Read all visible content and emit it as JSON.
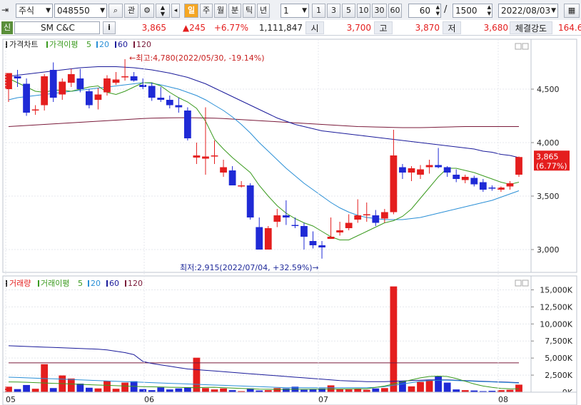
{
  "toolbar": {
    "market_select": "주식",
    "code": "048550",
    "btn_search_alt": "관",
    "period_selected": "일",
    "period_tabs": [
      "주",
      "월",
      "분",
      "틱",
      "년"
    ],
    "interval_value": "1",
    "interval_buttons": [
      "1",
      "3",
      "5",
      "10",
      "30",
      "60"
    ],
    "count_value": "60",
    "count_sep": "/",
    "count_total": "1500",
    "date_value": "2022/08/03"
  },
  "info": {
    "credit_badge": "신",
    "name": "SM C&C",
    "info_btn": "i",
    "price": "3,865",
    "change": "▲245",
    "change_pct": "+6.77%",
    "volume": "1,111,847",
    "open_label": "시",
    "open": "3,700",
    "high_label": "고",
    "high": "3,870",
    "low_label": "저",
    "low": "3,680",
    "strength_label": "체결강도",
    "strength": "164.6"
  },
  "colors": {
    "up": "#e41e1e",
    "down": "#1f2ad6",
    "ma5": "#3a9a1e",
    "ma20": "#2a8fd6",
    "ma60": "#1a1a9a",
    "ma120": "#7a1a3a"
  },
  "price_legend": {
    "title": "가격차트",
    "ma_label": "가격이평",
    "periods": [
      "5",
      "20",
      "60",
      "120"
    ]
  },
  "volume_legend": {
    "title": "거래량",
    "ma_label": "거래이평",
    "periods": [
      "5",
      "20",
      "60",
      "120"
    ]
  },
  "annotations": {
    "high": "←최고:4,780(2022/05/30, -19.14%)",
    "low": "최저:2,915(2022/07/04, +32.59%)→"
  },
  "current_tag": {
    "price": "3,865",
    "pct": "(6.77%)"
  },
  "chart_data": {
    "type": "candlestick",
    "x_labels": [
      "05",
      "06",
      "07",
      "08"
    ],
    "price_ticks": [
      "4,500",
      "4,000",
      "3,500",
      "3,000"
    ],
    "volume_ticks": [
      "15,000K",
      "12,500K",
      "10,000K",
      "7,500K",
      "5,000K",
      "2,500K",
      "0K"
    ],
    "candles": [
      {
        "o": 4500,
        "h": 4650,
        "l": 4380,
        "c": 4650
      },
      {
        "o": 4620,
        "h": 4680,
        "l": 4520,
        "c": 4600
      },
      {
        "o": 4550,
        "h": 4600,
        "l": 4250,
        "c": 4280
      },
      {
        "o": 4300,
        "h": 4350,
        "l": 4260,
        "c": 4310
      },
      {
        "o": 4350,
        "h": 4640,
        "l": 4300,
        "c": 4620
      },
      {
        "o": 4680,
        "h": 4750,
        "l": 4380,
        "c": 4420
      },
      {
        "o": 4450,
        "h": 4600,
        "l": 4400,
        "c": 4570
      },
      {
        "o": 4560,
        "h": 4690,
        "l": 4520,
        "c": 4640
      },
      {
        "o": 4600,
        "h": 4690,
        "l": 4470,
        "c": 4500
      },
      {
        "o": 4480,
        "h": 4500,
        "l": 4320,
        "c": 4350
      },
      {
        "o": 4400,
        "h": 4510,
        "l": 4310,
        "c": 4450
      },
      {
        "o": 4470,
        "h": 4630,
        "l": 4440,
        "c": 4600
      },
      {
        "o": 4560,
        "h": 4660,
        "l": 4540,
        "c": 4590
      },
      {
        "o": 4620,
        "h": 4780,
        "l": 4580,
        "c": 4620
      },
      {
        "o": 4620,
        "h": 4660,
        "l": 4570,
        "c": 4580
      },
      {
        "o": 4540,
        "h": 4600,
        "l": 4500,
        "c": 4520
      },
      {
        "o": 4530,
        "h": 4560,
        "l": 4390,
        "c": 4420
      },
      {
        "o": 4420,
        "h": 4520,
        "l": 4380,
        "c": 4400
      },
      {
        "o": 4400,
        "h": 4440,
        "l": 4320,
        "c": 4350
      },
      {
        "o": 4350,
        "h": 4420,
        "l": 4280,
        "c": 4330
      },
      {
        "o": 4300,
        "h": 4330,
        "l": 4020,
        "c": 4040
      },
      {
        "o": 3860,
        "h": 4000,
        "l": 3800,
        "c": 3880
      },
      {
        "o": 3850,
        "h": 4330,
        "l": 3700,
        "c": 3870
      },
      {
        "o": 3880,
        "h": 4020,
        "l": 3800,
        "c": 3880
      },
      {
        "o": 3720,
        "h": 3840,
        "l": 3680,
        "c": 3770
      },
      {
        "o": 3740,
        "h": 3780,
        "l": 3600,
        "c": 3600
      },
      {
        "o": 3600,
        "h": 3640,
        "l": 3580,
        "c": 3600
      },
      {
        "o": 3600,
        "h": 3620,
        "l": 3280,
        "c": 3300
      },
      {
        "o": 3210,
        "h": 3300,
        "l": 3000,
        "c": 3000
      },
      {
        "o": 3000,
        "h": 3220,
        "l": 3000,
        "c": 3200
      },
      {
        "o": 3260,
        "h": 3380,
        "l": 3210,
        "c": 3320
      },
      {
        "o": 3320,
        "h": 3460,
        "l": 3230,
        "c": 3300
      },
      {
        "o": 3230,
        "h": 3300,
        "l": 3200,
        "c": 3220
      },
      {
        "o": 3220,
        "h": 3250,
        "l": 3000,
        "c": 3120
      },
      {
        "o": 3080,
        "h": 3170,
        "l": 3010,
        "c": 3040
      },
      {
        "o": 3040,
        "h": 3080,
        "l": 2915,
        "c": 3020
      },
      {
        "o": 3100,
        "h": 3300,
        "l": 3100,
        "c": 3120
      },
      {
        "o": 3160,
        "h": 3260,
        "l": 3130,
        "c": 3180
      },
      {
        "o": 3200,
        "h": 3330,
        "l": 3180,
        "c": 3250
      },
      {
        "o": 3280,
        "h": 3470,
        "l": 3250,
        "c": 3320
      },
      {
        "o": 3330,
        "h": 3440,
        "l": 3260,
        "c": 3330
      },
      {
        "o": 3320,
        "h": 3370,
        "l": 3220,
        "c": 3250
      },
      {
        "o": 3290,
        "h": 3380,
        "l": 3250,
        "c": 3350
      },
      {
        "o": 3350,
        "h": 4120,
        "l": 3330,
        "c": 3880
      },
      {
        "o": 3770,
        "h": 3800,
        "l": 3660,
        "c": 3720
      },
      {
        "o": 3720,
        "h": 3780,
        "l": 3640,
        "c": 3760
      },
      {
        "o": 3700,
        "h": 3790,
        "l": 3660,
        "c": 3750
      },
      {
        "o": 3770,
        "h": 3840,
        "l": 3710,
        "c": 3790
      },
      {
        "o": 3790,
        "h": 3950,
        "l": 3760,
        "c": 3770
      },
      {
        "o": 3770,
        "h": 3780,
        "l": 3680,
        "c": 3720
      },
      {
        "o": 3700,
        "h": 3750,
        "l": 3630,
        "c": 3660
      },
      {
        "o": 3650,
        "h": 3700,
        "l": 3620,
        "c": 3680
      },
      {
        "o": 3670,
        "h": 3690,
        "l": 3590,
        "c": 3610
      },
      {
        "o": 3630,
        "h": 3660,
        "l": 3540,
        "c": 3560
      },
      {
        "o": 3580,
        "h": 3600,
        "l": 3550,
        "c": 3570
      },
      {
        "o": 3560,
        "h": 3590,
        "l": 3540,
        "c": 3580
      },
      {
        "o": 3590,
        "h": 3640,
        "l": 3560,
        "c": 3620
      },
      {
        "o": 3700,
        "h": 3870,
        "l": 3680,
        "c": 3865
      }
    ],
    "volumes_k": [
      800,
      450,
      1050,
      500,
      4100,
      600,
      2450,
      2000,
      1250,
      650,
      550,
      1650,
      500,
      1400,
      1600,
      450,
      300,
      700,
      400,
      550,
      700,
      5050,
      600,
      400,
      550,
      300,
      150,
      550,
      250,
      300,
      600,
      550,
      800,
      350,
      400,
      550,
      1000,
      400,
      400,
      500,
      350,
      550,
      600,
      15500,
      1600,
      850,
      1500,
      1800,
      2350,
      1400,
      400,
      300,
      250,
      150,
      200,
      300,
      350,
      1100
    ],
    "ma": {
      "ma5": [
        4600,
        4560,
        4520,
        4480,
        4470,
        4490,
        4490,
        4480,
        4500,
        4520,
        4530,
        4470,
        4450,
        4480,
        4520,
        4560,
        4560,
        4530,
        4470,
        4420,
        4380,
        4320,
        4200,
        4030,
        3940,
        3860,
        3790,
        3720,
        3600,
        3500,
        3410,
        3340,
        3290,
        3250,
        3220,
        3170,
        3120,
        3090,
        3090,
        3130,
        3170,
        3210,
        3250,
        3270,
        3310,
        3380,
        3480,
        3580,
        3680,
        3760,
        3760,
        3740,
        3720,
        3690,
        3660,
        3630,
        3610,
        3630
      ],
      "ma20": [
        4400,
        4420,
        4430,
        4440,
        4450,
        4460,
        4470,
        4480,
        4490,
        4500,
        4510,
        4520,
        4530,
        4540,
        4550,
        4560,
        4555,
        4540,
        4520,
        4500,
        4470,
        4440,
        4400,
        4350,
        4300,
        4240,
        4170,
        4090,
        4000,
        3920,
        3840,
        3760,
        3690,
        3620,
        3560,
        3500,
        3440,
        3390,
        3350,
        3320,
        3300,
        3290,
        3280,
        3280,
        3280,
        3290,
        3300,
        3320,
        3340,
        3360,
        3380,
        3400,
        3420,
        3440,
        3460,
        3490,
        3520,
        3550
      ],
      "ma60": [
        4620,
        4630,
        4640,
        4650,
        4660,
        4670,
        4680,
        4690,
        4700,
        4705,
        4710,
        4710,
        4710,
        4705,
        4700,
        4690,
        4680,
        4665,
        4650,
        4630,
        4610,
        4580,
        4550,
        4510,
        4470,
        4430,
        4390,
        4350,
        4310,
        4270,
        4230,
        4200,
        4170,
        4150,
        4130,
        4110,
        4100,
        4090,
        4080,
        4070,
        4060,
        4050,
        4040,
        4030,
        4020,
        4010,
        4000,
        3990,
        3980,
        3970,
        3960,
        3950,
        3940,
        3920,
        3910,
        3890,
        3880,
        3860
      ],
      "ma120": [
        4150,
        4155,
        4160,
        4165,
        4170,
        4175,
        4180,
        4185,
        4190,
        4195,
        4200,
        4205,
        4210,
        4215,
        4220,
        4225,
        4228,
        4230,
        4232,
        4233,
        4233,
        4232,
        4230,
        4228,
        4225,
        4220,
        4215,
        4210,
        4205,
        4200,
        4195,
        4190,
        4185,
        4180,
        4175,
        4170,
        4165,
        4160,
        4155,
        4150,
        4148,
        4146,
        4144,
        4142,
        4140,
        4140,
        4140,
        4142,
        4144,
        4146,
        4148,
        4150,
        4150,
        4150,
        4150,
        4150,
        4150,
        4150
      ],
      "vma5": [
        1500,
        1480,
        1450,
        1400,
        1350,
        1300,
        1250,
        1200,
        1150,
        1100,
        1050,
        1000,
        950,
        900,
        850,
        800,
        780,
        760,
        720,
        700,
        680,
        650,
        700,
        720,
        650,
        600,
        550,
        500,
        450,
        430,
        420,
        410,
        420,
        430,
        440,
        450,
        460,
        470,
        480,
        490,
        500,
        700,
        900,
        1200,
        1500,
        1800,
        2100,
        2300,
        2350,
        2300,
        2000,
        1600,
        1200,
        900,
        700,
        550,
        500,
        480
      ],
      "vma20": [
        2200,
        2150,
        2100,
        2050,
        2000,
        1950,
        1900,
        1850,
        1800,
        1750,
        1700,
        1650,
        1600,
        1550,
        1500,
        1450,
        1400,
        1350,
        1300,
        1250,
        1200,
        1150,
        1100,
        1050,
        1000,
        950,
        900,
        850,
        800,
        750,
        700,
        650,
        650,
        650,
        650,
        650,
        650,
        650,
        650,
        650,
        650,
        700,
        800,
        1000,
        1200,
        1400,
        1600,
        1700,
        1750,
        1750,
        1700,
        1650,
        1600,
        1550,
        1500,
        1450,
        1400,
        1350
      ],
      "vma60": [
        6800,
        6750,
        6700,
        6650,
        6600,
        6550,
        6500,
        6450,
        6400,
        6350,
        6300,
        6200,
        6000,
        5800,
        5500,
        4500,
        4200,
        4000,
        3800,
        3600,
        3400,
        3300,
        3200,
        3100,
        3000,
        2900,
        2800,
        2700,
        2600,
        2500,
        2400,
        2300,
        2200,
        2100,
        2000,
        1900,
        1800,
        1700,
        1650,
        1600,
        1550,
        1550,
        1550,
        1600,
        1650,
        1700,
        1750,
        1800,
        1800,
        1800,
        1750,
        1700,
        1650,
        1600,
        1550,
        1500,
        1450,
        1400
      ],
      "vma120": [
        4300,
        4300,
        4300,
        4300,
        4300,
        4300,
        4300,
        4300,
        4300,
        4300,
        4300,
        4300,
        4300,
        4300,
        4300,
        4300,
        4300,
        4300,
        4300,
        4300,
        4300,
        4300,
        4300,
        4300,
        4300,
        4300,
        4300,
        4300,
        4300,
        4300,
        4300,
        4300,
        4300,
        4300,
        4300,
        4300,
        4300,
        4300,
        4300,
        4300,
        4300,
        4300,
        4300,
        4300,
        4300,
        4300,
        4300,
        4300,
        4300,
        4300,
        4300,
        4300,
        4300,
        4300,
        4300,
        4300,
        4300,
        4300
      ]
    }
  }
}
